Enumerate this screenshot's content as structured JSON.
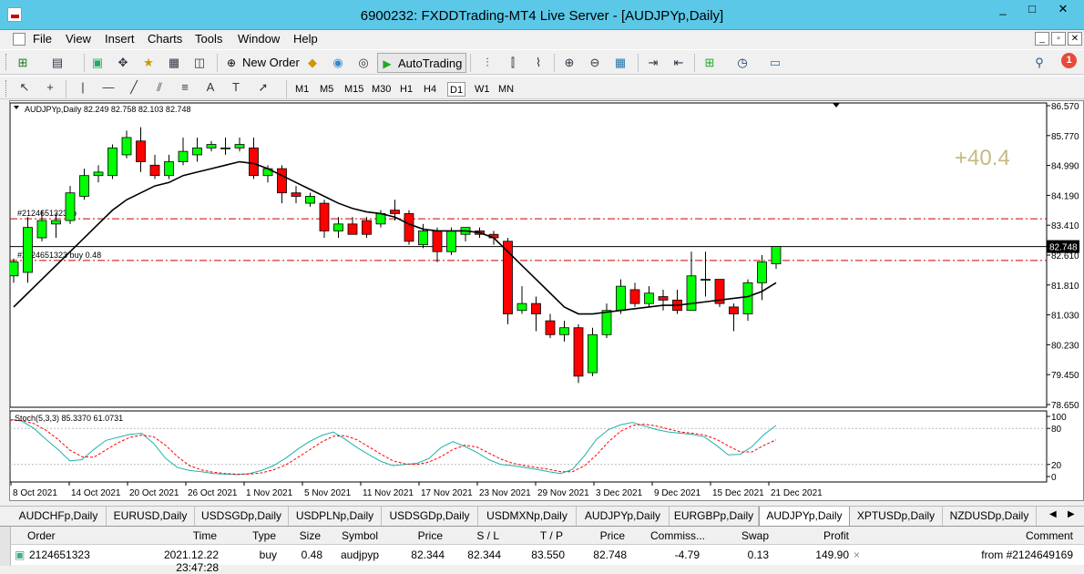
{
  "window": {
    "title": "6900232: FXDDTrading-MT4 Live Server - [AUDJPYp,Daily]",
    "controls": [
      "_",
      "□",
      "✕"
    ]
  },
  "menu": {
    "items": [
      "File",
      "View",
      "Insert",
      "Charts",
      "Tools",
      "Window",
      "Help"
    ],
    "mdi_controls": [
      "_",
      "▫",
      "✕"
    ]
  },
  "toolbar": {
    "new_order_label": "New Order",
    "autotrading_label": "AutoTrading",
    "notifications_count": "1"
  },
  "timeframes": {
    "items": [
      "M1",
      "M5",
      "M15",
      "M30",
      "H1",
      "H4",
      "D1",
      "W1",
      "MN"
    ],
    "active": "D1"
  },
  "chart": {
    "symbol_header": "AUDJPYp,Daily  82.249 82.758 82.103 82.748",
    "profit_overlay": "+40.4",
    "current_price_label": "82.748",
    "order_line_tp_label": "#2124651323 tp",
    "order_line_buy_label": "#2124651323 buy 0.48",
    "stoch_header": "Stoch(5,3,3) 85.3370 61.0731",
    "colors": {
      "bull_candle": "#00ff00",
      "bear_candle": "#ff0000",
      "ma_line": "#000000",
      "stoch_main": "#20b2aa",
      "stoch_signal": "#ff0000",
      "order_line": "#cc0000",
      "profit_text": "#c8b982"
    }
  },
  "chart_data": [
    {
      "type": "candlestick",
      "title": "AUDJPYp,Daily",
      "ylim": [
        78.1,
        86.9
      ],
      "y_ticks": [
        "86.570",
        "85.770",
        "84.990",
        "84.190",
        "83.410",
        "82.610",
        "81.810",
        "81.030",
        "80.230",
        "79.450",
        "78.650"
      ],
      "x_ticks": [
        "8 Oct 2021",
        "14 Oct 2021",
        "20 Oct 2021",
        "26 Oct 2021",
        "1 Nov 2021",
        "5 Nov 2021",
        "11 Nov 2021",
        "17 Nov 2021",
        "23 Nov 2021",
        "29 Nov 2021",
        "3 Dec 2021",
        "9 Dec 2021",
        "15 Dec 2021",
        "21 Dec 2021"
      ],
      "candles": [
        {
          "o": 81.9,
          "h": 82.4,
          "l": 81.7,
          "c": 82.3
        },
        {
          "o": 82.0,
          "h": 83.6,
          "l": 81.7,
          "c": 83.3
        },
        {
          "o": 83.0,
          "h": 83.8,
          "l": 82.9,
          "c": 83.5
        },
        {
          "o": 83.4,
          "h": 83.7,
          "l": 83.0,
          "c": 83.5
        },
        {
          "o": 83.5,
          "h": 84.5,
          "l": 83.4,
          "c": 84.3
        },
        {
          "o": 84.2,
          "h": 85.0,
          "l": 84.1,
          "c": 84.8
        },
        {
          "o": 84.8,
          "h": 85.1,
          "l": 84.6,
          "c": 84.9
        },
        {
          "o": 84.8,
          "h": 85.7,
          "l": 84.7,
          "c": 85.6
        },
        {
          "o": 85.4,
          "h": 86.1,
          "l": 85.3,
          "c": 85.9
        },
        {
          "o": 85.8,
          "h": 86.2,
          "l": 84.9,
          "c": 85.2
        },
        {
          "o": 85.1,
          "h": 85.4,
          "l": 84.7,
          "c": 84.8
        },
        {
          "o": 84.8,
          "h": 85.4,
          "l": 84.7,
          "c": 85.2
        },
        {
          "o": 85.2,
          "h": 85.9,
          "l": 85.1,
          "c": 85.5
        },
        {
          "o": 85.4,
          "h": 85.9,
          "l": 85.2,
          "c": 85.6
        },
        {
          "o": 85.6,
          "h": 85.8,
          "l": 85.5,
          "c": 85.7
        },
        {
          "o": 85.6,
          "h": 85.9,
          "l": 85.4,
          "c": 85.6
        },
        {
          "o": 85.6,
          "h": 85.9,
          "l": 85.5,
          "c": 85.7
        },
        {
          "o": 85.6,
          "h": 85.9,
          "l": 84.7,
          "c": 84.8
        },
        {
          "o": 84.8,
          "h": 85.1,
          "l": 84.6,
          "c": 85.0
        },
        {
          "o": 85.0,
          "h": 85.1,
          "l": 84.0,
          "c": 84.3
        },
        {
          "o": 84.3,
          "h": 84.5,
          "l": 84.0,
          "c": 84.2
        },
        {
          "o": 84.0,
          "h": 84.3,
          "l": 83.9,
          "c": 84.2
        },
        {
          "o": 84.0,
          "h": 84.1,
          "l": 83.0,
          "c": 83.2
        },
        {
          "o": 83.2,
          "h": 83.6,
          "l": 83.0,
          "c": 83.4
        },
        {
          "o": 83.4,
          "h": 83.6,
          "l": 83.1,
          "c": 83.1
        },
        {
          "o": 83.5,
          "h": 83.6,
          "l": 83.0,
          "c": 83.1
        },
        {
          "o": 83.4,
          "h": 83.8,
          "l": 83.3,
          "c": 83.7
        },
        {
          "o": 83.8,
          "h": 84.1,
          "l": 83.5,
          "c": 83.7
        },
        {
          "o": 83.7,
          "h": 83.8,
          "l": 82.8,
          "c": 82.9
        },
        {
          "o": 82.8,
          "h": 83.4,
          "l": 82.7,
          "c": 83.2
        },
        {
          "o": 83.2,
          "h": 83.3,
          "l": 82.3,
          "c": 82.6
        },
        {
          "o": 82.6,
          "h": 83.3,
          "l": 82.5,
          "c": 83.2
        },
        {
          "o": 83.1,
          "h": 83.3,
          "l": 82.9,
          "c": 83.3
        },
        {
          "o": 83.2,
          "h": 83.3,
          "l": 83.0,
          "c": 83.1
        },
        {
          "o": 83.1,
          "h": 83.2,
          "l": 82.8,
          "c": 83.0
        },
        {
          "o": 82.9,
          "h": 83.0,
          "l": 80.5,
          "c": 80.8
        },
        {
          "o": 80.9,
          "h": 81.6,
          "l": 80.8,
          "c": 81.1
        },
        {
          "o": 81.1,
          "h": 81.3,
          "l": 80.3,
          "c": 80.8
        },
        {
          "o": 80.6,
          "h": 80.8,
          "l": 80.1,
          "c": 80.2
        },
        {
          "o": 80.2,
          "h": 80.6,
          "l": 80.0,
          "c": 80.4
        },
        {
          "o": 80.4,
          "h": 80.5,
          "l": 78.8,
          "c": 79.0
        },
        {
          "o": 79.1,
          "h": 80.4,
          "l": 79.0,
          "c": 80.2
        },
        {
          "o": 80.2,
          "h": 81.1,
          "l": 80.1,
          "c": 80.9
        },
        {
          "o": 80.9,
          "h": 81.8,
          "l": 80.8,
          "c": 81.6
        },
        {
          "o": 81.5,
          "h": 81.7,
          "l": 81.0,
          "c": 81.1
        },
        {
          "o": 81.1,
          "h": 81.6,
          "l": 81.0,
          "c": 81.4
        },
        {
          "o": 81.3,
          "h": 81.5,
          "l": 80.9,
          "c": 81.2
        },
        {
          "o": 81.2,
          "h": 81.5,
          "l": 80.8,
          "c": 80.9
        },
        {
          "o": 80.9,
          "h": 82.6,
          "l": 80.9,
          "c": 81.9
        },
        {
          "o": 81.8,
          "h": 82.6,
          "l": 81.3,
          "c": 81.8
        },
        {
          "o": 81.8,
          "h": 81.8,
          "l": 81.0,
          "c": 81.1
        },
        {
          "o": 81.0,
          "h": 81.1,
          "l": 80.3,
          "c": 80.8
        },
        {
          "o": 80.8,
          "h": 81.8,
          "l": 80.6,
          "c": 81.7
        },
        {
          "o": 81.7,
          "h": 82.5,
          "l": 81.2,
          "c": 82.3
        },
        {
          "o": 82.249,
          "h": 82.758,
          "l": 82.103,
          "c": 82.748
        }
      ],
      "ma_values": [
        81.0,
        81.4,
        81.8,
        82.2,
        82.6,
        83.0,
        83.4,
        83.8,
        84.1,
        84.3,
        84.5,
        84.6,
        84.8,
        84.9,
        85.0,
        85.1,
        85.2,
        85.15,
        85.0,
        84.8,
        84.6,
        84.4,
        84.2,
        84.0,
        83.85,
        83.75,
        83.7,
        83.6,
        83.4,
        83.25,
        83.2,
        83.2,
        83.2,
        83.15,
        83.0,
        82.6,
        82.2,
        81.8,
        81.4,
        81.0,
        80.8,
        80.8,
        80.85,
        80.9,
        80.95,
        81.0,
        81.05,
        81.05,
        81.1,
        81.15,
        81.2,
        81.25,
        81.3,
        81.45,
        81.7
      ],
      "current_price": 82.748,
      "order_levels": {
        "tp": 83.55,
        "buy": 82.344
      }
    },
    {
      "type": "line",
      "title": "Stoch(5,3,3) 85.3370 61.0731",
      "ylim": [
        0,
        100
      ],
      "y_ticks": [
        "100",
        "80",
        "20",
        "0"
      ],
      "series": [
        {
          "name": "Main",
          "values": [
            95,
            92,
            80,
            62,
            45,
            26,
            28,
            45,
            60,
            65,
            70,
            72,
            55,
            30,
            15,
            10,
            8,
            5,
            4,
            3,
            5,
            10,
            18,
            30,
            45,
            58,
            68,
            74,
            62,
            48,
            36,
            25,
            18,
            20,
            22,
            30,
            48,
            58,
            50,
            40,
            28,
            20,
            18,
            15,
            12,
            8,
            5,
            12,
            35,
            62,
            78,
            86,
            90,
            84,
            78,
            74,
            72,
            70,
            66,
            52,
            36,
            37,
            50,
            70,
            85
          ]
        },
        {
          "name": "Signal",
          "values": [
            94,
            93,
            88,
            77,
            62,
            44,
            33,
            32,
            44,
            56,
            65,
            69,
            66,
            52,
            33,
            18,
            11,
            7,
            5,
            4,
            4,
            6,
            11,
            19,
            31,
            44,
            57,
            67,
            68,
            61,
            49,
            37,
            26,
            21,
            20,
            24,
            33,
            45,
            52,
            49,
            39,
            29,
            22,
            18,
            15,
            12,
            8,
            8,
            18,
            36,
            58,
            75,
            85,
            87,
            84,
            79,
            74,
            72,
            69,
            62,
            51,
            41,
            41,
            52,
            61
          ]
        }
      ]
    }
  ],
  "symbol_tabs": {
    "items": [
      "AUDCHFp,Daily",
      "EURUSD,Daily",
      "USDSGDp,Daily",
      "USDPLNp,Daily",
      "USDSGDp,Daily",
      "USDMXNp,Daily",
      "AUDJPYp,Daily",
      "EURGBPp,Daily",
      "AUDJPYp,Daily",
      "XPTUSDp,Daily",
      "NZDUSDp,Daily"
    ],
    "active_index": 8
  },
  "terminal": {
    "headers": [
      "Order",
      "Time",
      "Type",
      "Size",
      "Symbol",
      "Price",
      "S / L",
      "T / P",
      "Price",
      "Commiss...",
      "Swap",
      "Profit",
      "Comment"
    ],
    "rows": [
      {
        "order": "2124651323",
        "time": "2021.12.22 23:47:28",
        "type": "buy",
        "size": "0.48",
        "symbol": "audjpyp",
        "price": "82.344",
        "sl": "82.344",
        "tp": "83.550",
        "cur_price": "82.748",
        "commission": "-4.79",
        "swap": "0.13",
        "profit": "149.90",
        "comment": "from #2124649169"
      }
    ]
  }
}
